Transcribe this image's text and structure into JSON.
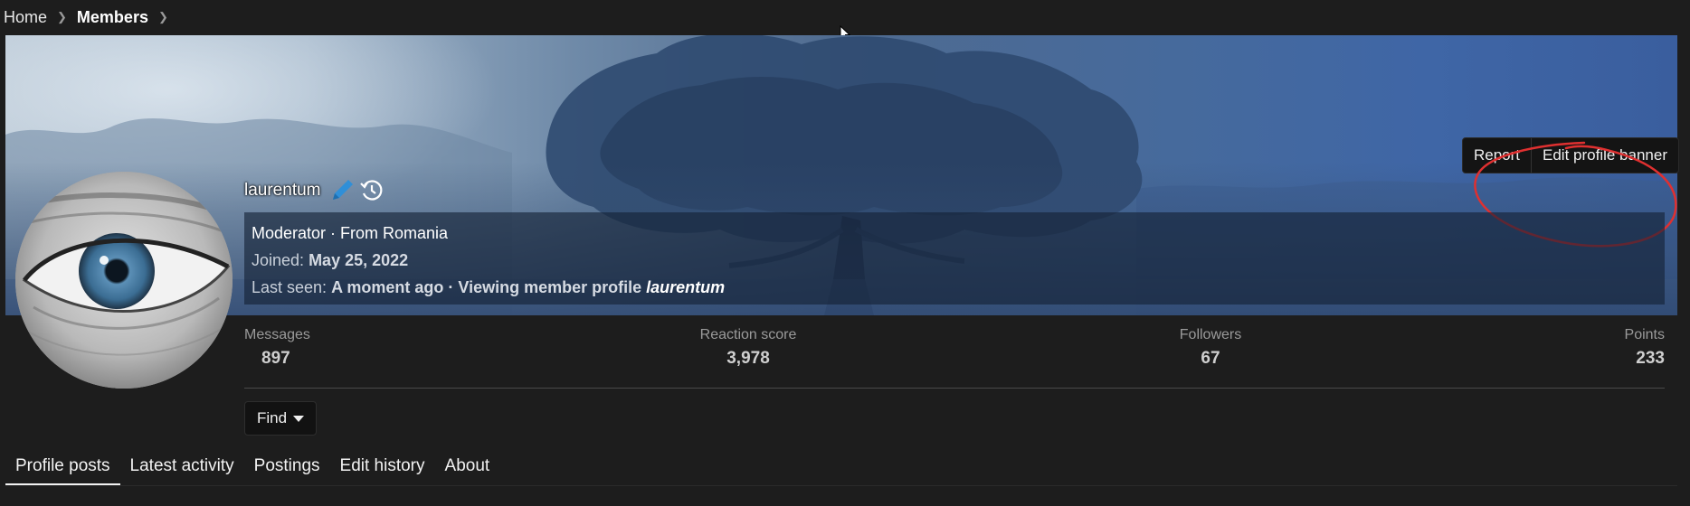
{
  "breadcrumb": {
    "home": "Home",
    "members": "Members"
  },
  "banner": {
    "report_label": "Report",
    "edit_banner_label": "Edit profile banner"
  },
  "profile": {
    "username": "laurentum",
    "role_line": "Moderator · From Romania",
    "joined_label": "Joined:",
    "joined_value": "May 25, 2022",
    "last_seen_label": "Last seen:",
    "last_seen_value": "A moment ago · Viewing member profile",
    "last_seen_user": "laurentum"
  },
  "stats": [
    {
      "label": "Messages",
      "value": "897"
    },
    {
      "label": "Reaction score",
      "value": "3,978"
    },
    {
      "label": "Followers",
      "value": "67"
    },
    {
      "label": "Points",
      "value": "233"
    }
  ],
  "find_label": "Find",
  "tabs": [
    {
      "label": "Profile posts",
      "active": true
    },
    {
      "label": "Latest activity"
    },
    {
      "label": "Postings"
    },
    {
      "label": "Edit history"
    },
    {
      "label": "About"
    }
  ],
  "icons": {
    "edit": "pencil-icon",
    "history": "history-icon",
    "breadcrumb_separator": "chevron-right-icon",
    "find_caret": "caret-down-icon",
    "cursor": "mouse-cursor-icon"
  },
  "colors": {
    "page_background": "#1d1d1d",
    "pencil_accent": "#2f8fd8",
    "annotation_red": "#e03030"
  }
}
